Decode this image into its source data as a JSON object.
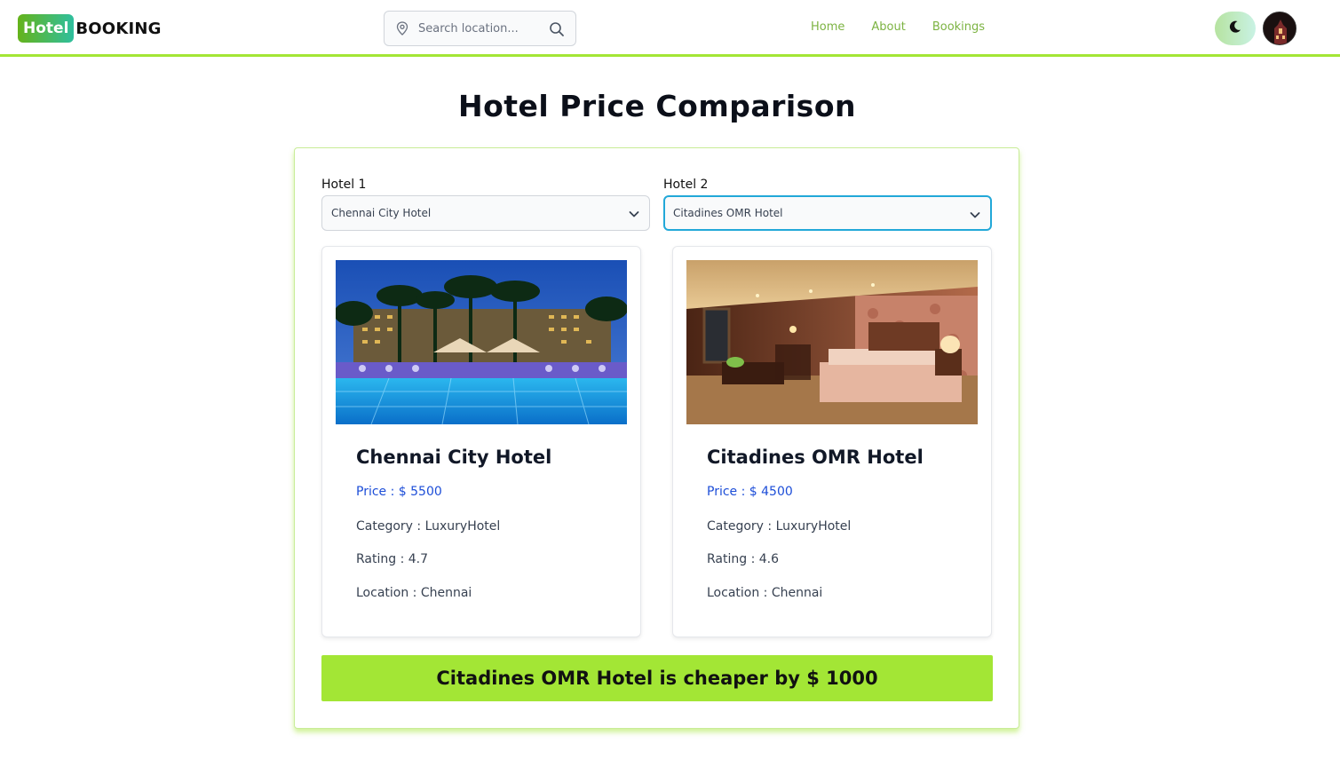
{
  "header": {
    "logo_badge": "Hotel",
    "logo_text": "BOOKING",
    "search_placeholder": "Search location...",
    "nav": [
      "Home",
      "About",
      "Bookings"
    ],
    "accent_color": "#a3e635",
    "link_color": "#7cb342"
  },
  "page": {
    "title": "Hotel Price Comparison"
  },
  "selectors": {
    "hotel1": {
      "label": "Hotel 1",
      "value": "Chennai City Hotel"
    },
    "hotel2": {
      "label": "Hotel 2",
      "value": "Citadines OMR Hotel"
    }
  },
  "hotels": [
    {
      "name": "Chennai City Hotel",
      "price": "Price : $ 5500",
      "category": "Category : LuxuryHotel",
      "rating": "Rating : 4.7",
      "location": "Location : Chennai",
      "image_icon": "resort-pool-photo"
    },
    {
      "name": "Citadines OMR Hotel",
      "price": "Price : $ 4500",
      "category": "Category : LuxuryHotel",
      "rating": "Rating : 4.6",
      "location": "Location : Chennai",
      "image_icon": "hotel-room-photo"
    }
  ],
  "result": {
    "text": "Citadines OMR Hotel is cheaper by $ 1000"
  }
}
